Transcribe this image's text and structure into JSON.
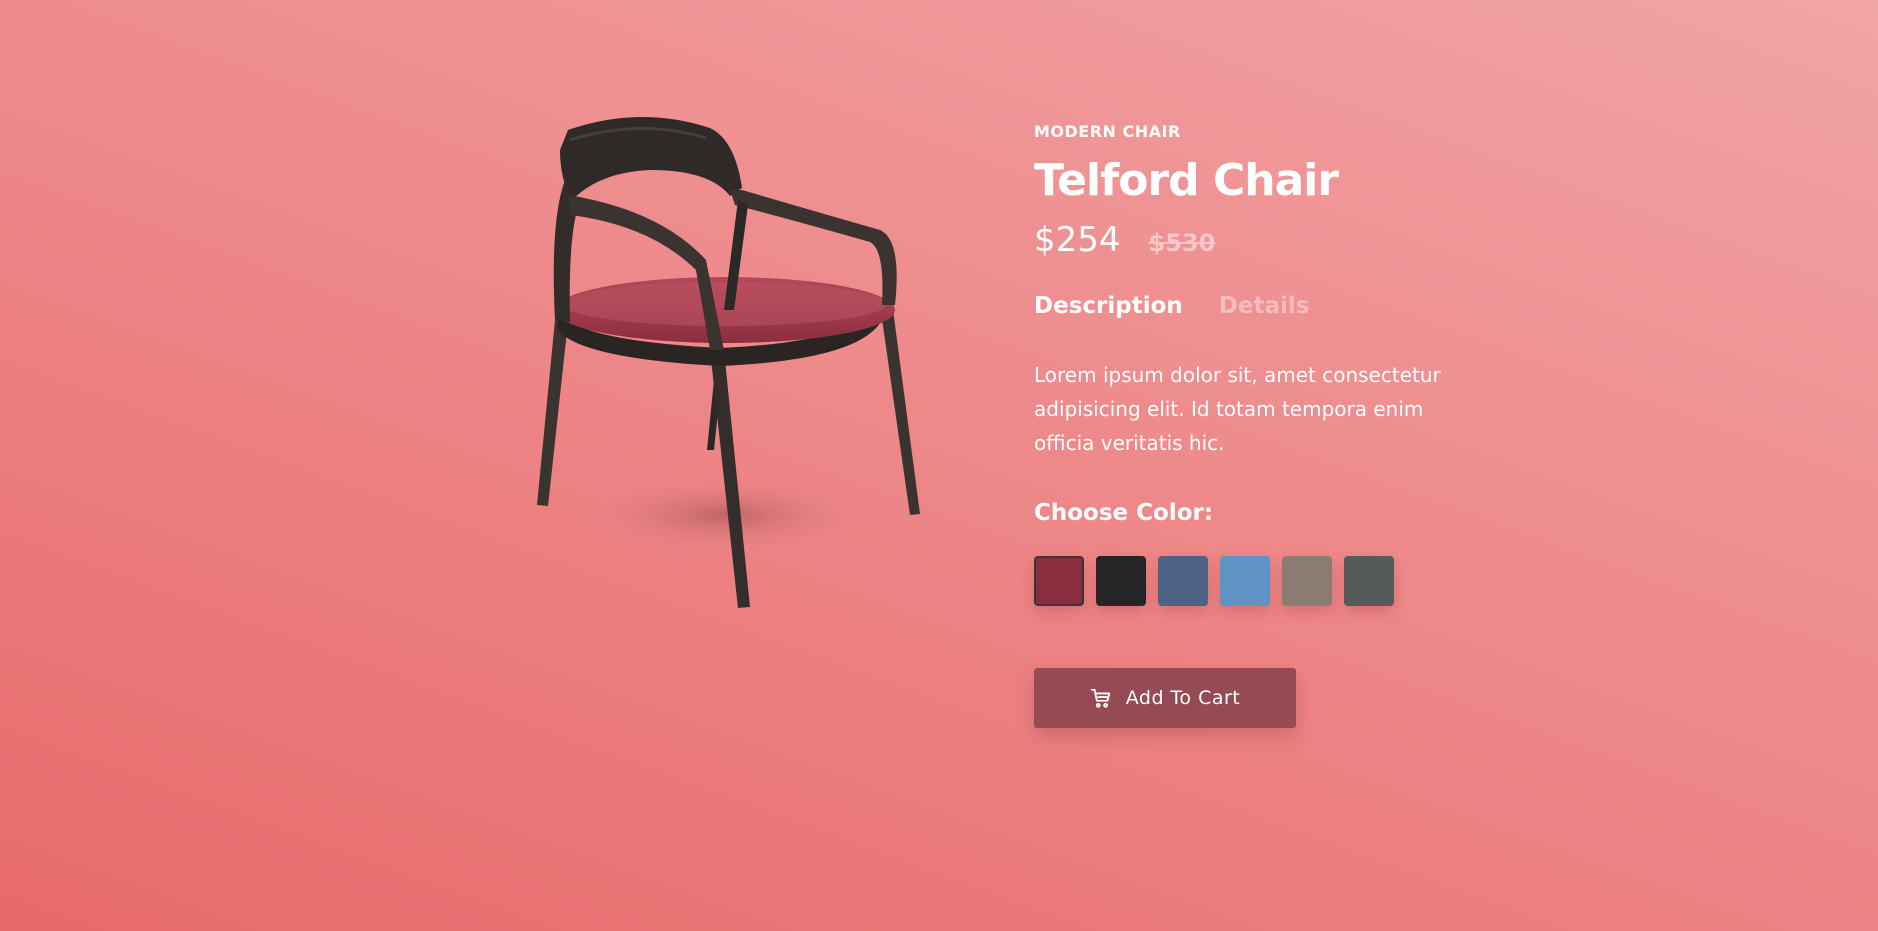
{
  "product": {
    "category": "MODERN CHAIR",
    "name": "Telford Chair",
    "price": "$254",
    "old_price": "$530",
    "image_icon": "chair-image"
  },
  "tabs": [
    {
      "label": "Description",
      "active": true
    },
    {
      "label": "Details",
      "active": false
    }
  ],
  "description": "Lorem ipsum dolor sit, amet consectetur adipisicing elit. Id totam tempora enim officia veritatis hic.",
  "colors": {
    "label": "Choose Color:",
    "selected_index": 0,
    "swatches": [
      {
        "name": "burgundy",
        "color": "#8a2d3f"
      },
      {
        "name": "black",
        "color": "#252527"
      },
      {
        "name": "denim",
        "color": "#4e6383"
      },
      {
        "name": "light-blue",
        "color": "#5f93c6"
      },
      {
        "name": "taupe",
        "color": "#8c7b72"
      },
      {
        "name": "grey",
        "color": "#555b58"
      }
    ]
  },
  "cart": {
    "label": "Add To Cart",
    "icon": "cart-icon",
    "background": "#964a54"
  }
}
